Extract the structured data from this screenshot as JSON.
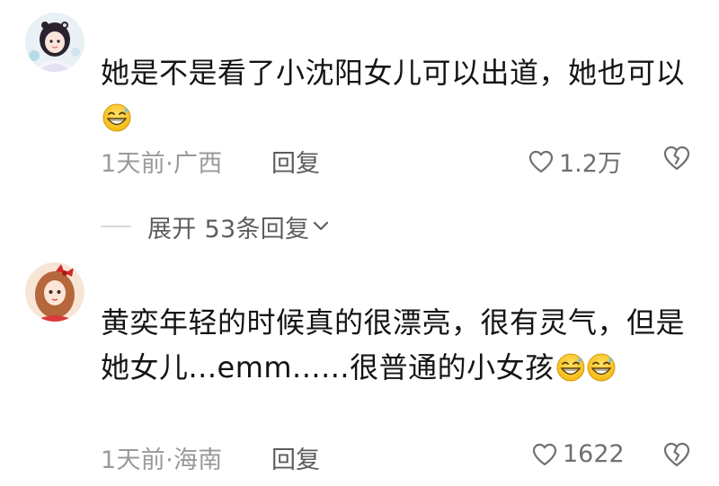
{
  "comments": [
    {
      "avatar": "avatar-girl-white-dress",
      "text": "她是不是看了小沈阳女儿可以出道，她也可以",
      "emoji": "grinning-sweat-emoji",
      "time": "1天前",
      "location": "广西",
      "reply_label": "回复",
      "likes": "1.2万",
      "expand_label": "展开 53条回复"
    },
    {
      "avatar": "avatar-girl-red-bow",
      "text": "黄奕年轻的时候真的很漂亮，很有灵气，但是她女儿...emm......很普通的小女孩",
      "emoji": "grinning-sweat-emoji",
      "time": "1天前",
      "location": "海南",
      "reply_label": "回复",
      "likes": "1622"
    }
  ],
  "colors": {
    "meta_gray": "#9a9a9a",
    "text": "#141414"
  }
}
